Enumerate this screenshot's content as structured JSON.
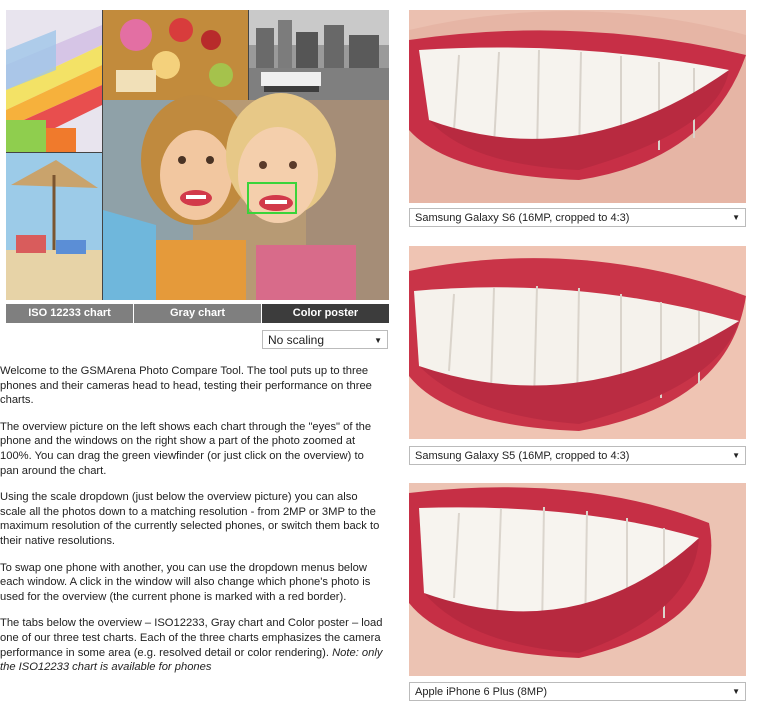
{
  "overview": {
    "tabs": [
      {
        "label": "ISO 12233 chart",
        "active": false
      },
      {
        "label": "Gray chart",
        "active": false
      },
      {
        "label": "Color poster",
        "active": true
      }
    ],
    "scale_selected": "No scaling"
  },
  "description": {
    "p1": "Welcome to the GSMArena Photo Compare Tool. The tool puts up to three phones and their cameras head to head, testing their performance on three charts.",
    "p2": "The overview picture on the left shows each chart through the \"eyes\" of the phone and the windows on the right show a part of the photo zoomed at 100%. You can drag the green viewfinder (or just click on the overview) to pan around the chart.",
    "p3": "Using the scale dropdown (just below the overview picture) you can also scale all the photos down to a matching resolution - from 2MP or 3MP to the maximum resolution of the currently selected phones, or switch them back to their native resolutions.",
    "p4": "To swap one phone with another, you can use the dropdown menus below each window. A click in the window will also change which phone's photo is used for the overview (the current phone is marked with a red border).",
    "p5": "The tabs below the overview – ISO12233, Gray chart and Color poster – load one of our three test charts. Each of the three charts emphasizes the camera performance in some area (e.g. resolved detail or color rendering).",
    "p5_note": "Note: only the ISO12233 chart is available for phones"
  },
  "phones": [
    {
      "label": "Samsung Galaxy S6 (16MP, cropped to 4:3)"
    },
    {
      "label": "Samsung Galaxy S5 (16MP, cropped to 4:3)"
    },
    {
      "label": "Apple iPhone 6 Plus (8MP)"
    }
  ],
  "colors": {
    "viewfinder": "#3ad43a",
    "active_tab": "#3c3c3c",
    "inactive_tab": "#7f7f7f",
    "lip": "#c8334a"
  }
}
